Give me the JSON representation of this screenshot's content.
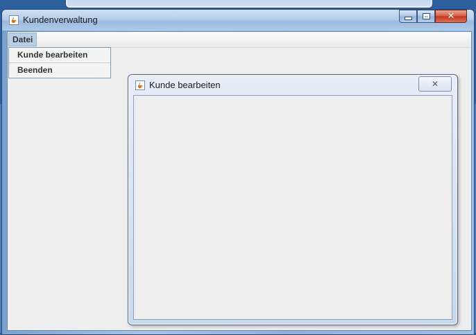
{
  "main_window": {
    "title": "Kundenverwaltung",
    "buttons": {
      "minimize": "minimize",
      "maximize": "maximize",
      "close": "close"
    }
  },
  "menubar": {
    "menus": [
      {
        "label": "Datei"
      }
    ]
  },
  "dropdown": {
    "items": [
      {
        "label": "Kunde bearbeiten"
      },
      {
        "label": "Beenden"
      }
    ]
  },
  "internal_frame": {
    "title": "Kunde bearbeiten"
  },
  "icons": [
    "java-app-icon",
    "minimize-icon",
    "maximize-icon",
    "close-icon"
  ]
}
